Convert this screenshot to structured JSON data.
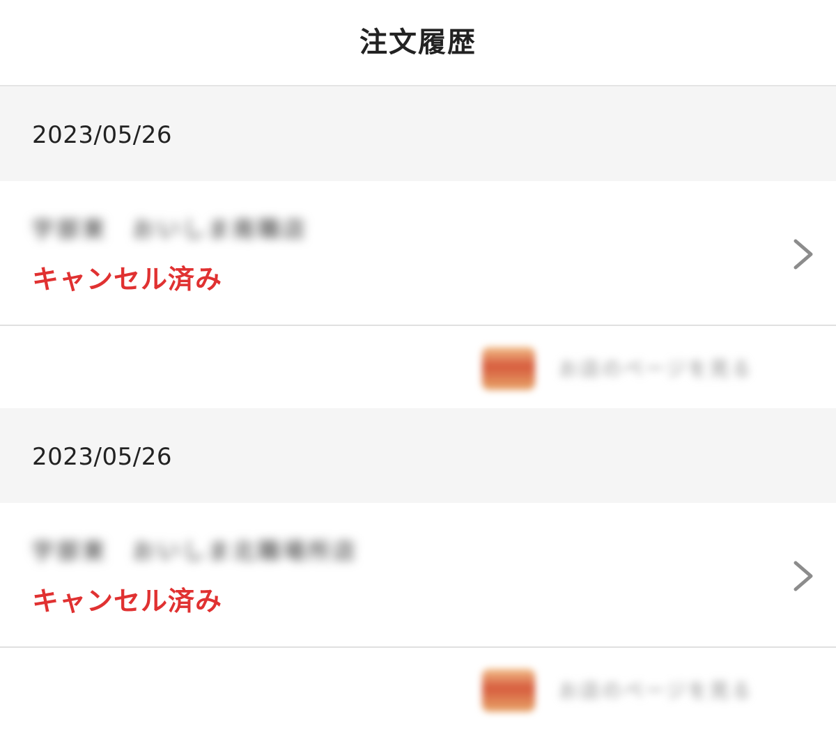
{
  "header": {
    "title": "注文履歴"
  },
  "orders": [
    {
      "date": "2023/05/26",
      "store_name": "宇部東　おいしま南職店",
      "status": "キャンセル済み",
      "promo_text": "お店のページを見る"
    },
    {
      "date": "2023/05/26",
      "store_name": "宇部東　おいしま北職場所店",
      "status": "キャンセル済み",
      "promo_text": "お店のページを見る"
    }
  ],
  "colors": {
    "status_cancelled": "#e03131",
    "date_band": "#f5f5f5",
    "divider": "#e0e0e0"
  },
  "icons": {
    "row_arrow": "chevron-right-icon",
    "promo_image": "store-thumbnail-icon"
  }
}
